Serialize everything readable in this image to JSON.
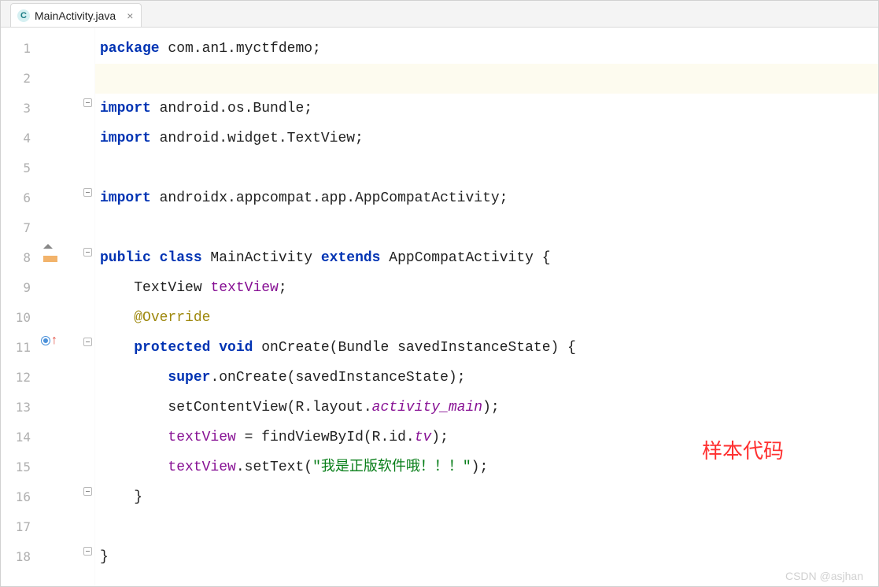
{
  "tab": {
    "filename": "MainActivity.java",
    "icon_letter": "C"
  },
  "lines": {
    "count": 18,
    "l1": {
      "t1": "package",
      "t2": " com.an1.myctfdemo;",
      "fold": false
    },
    "l2": {
      "blank": true,
      "highlighted": true
    },
    "l3": {
      "t1": "import",
      "t2": " android.os.Bundle;",
      "fold": true
    },
    "l4": {
      "t1": "import",
      "t2": " android.widget.TextView;"
    },
    "l5": {
      "blank": true
    },
    "l6": {
      "t1": "import",
      "t2": " androidx.appcompat.app.AppCompatActivity;",
      "fold": true
    },
    "l7": {
      "blank": true
    },
    "l8": {
      "t1": "public class",
      "t2": " MainActivity ",
      "t3": "extends",
      "t4": " AppCompatActivity {",
      "fold": true,
      "class_icon": true
    },
    "l9": {
      "indent": 1,
      "t1": "TextView ",
      "t2": "textView",
      "t3": ";"
    },
    "l10": {
      "indent": 1,
      "t1": "@Override"
    },
    "l11": {
      "indent": 1,
      "t1": "protected void",
      "t2": " onCreate(Bundle savedInstanceState) {",
      "fold": true,
      "override_icon": true
    },
    "l12": {
      "indent": 2,
      "t1": "super",
      "t2": ".onCreate(savedInstanceState);"
    },
    "l13": {
      "indent": 2,
      "t1": "setContentView(R.layout.",
      "t2": "activity_main",
      "t3": ");"
    },
    "l14": {
      "indent": 2,
      "t1": "textView",
      "t2": " = findViewById(R.id.",
      "t3": "tv",
      "t4": ");"
    },
    "l15": {
      "indent": 2,
      "t1": "textView",
      "t2": ".setText(",
      "t3": "\"我是正版软件哦！！！\"",
      "t4": ");"
    },
    "l16": {
      "indent": 1,
      "t1": "}",
      "fold": true
    },
    "l17": {
      "blank": true
    },
    "l18": {
      "t1": "}",
      "fold": true
    }
  },
  "annotation": "样本代码",
  "watermark": "CSDN @asjhan"
}
